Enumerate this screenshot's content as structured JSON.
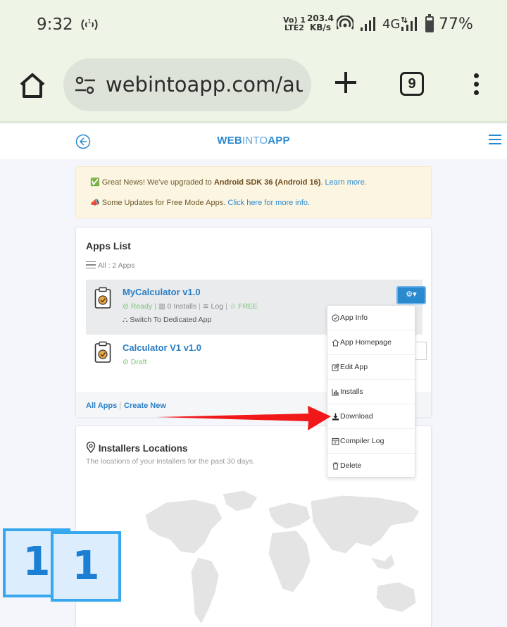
{
  "status_bar": {
    "time": "9:32",
    "volte_line1": "Vo) 1",
    "volte_line2": "LTE2",
    "speed_value": "203.4",
    "speed_unit": "KB/s",
    "network": "4G",
    "battery_percent_text": "77%",
    "battery_level": 0.77
  },
  "browser": {
    "url": "webintoapp.com/aut",
    "tab_count": "9",
    "icons": [
      "home-icon",
      "tune-icon",
      "plus-icon",
      "tabs-icon",
      "more-vert-icon"
    ]
  },
  "site_header": {
    "logo_part1": "WEB",
    "logo_part2": "INTO",
    "logo_part3": "APP"
  },
  "alerts": {
    "line1_emoji": "✅",
    "line1_text": "Great News! We've upgraded to ",
    "line1_bold": "Android SDK 36 (Android 16)",
    "line1_after": ". ",
    "line1_link": "Learn more.",
    "line2_emoji": "📣",
    "line2_text": "Some Updates for Free Mode Apps. ",
    "line2_link": "Click here for more info."
  },
  "apps_card": {
    "title": "Apps List",
    "count_label": "All : 2 Apps",
    "apps": [
      {
        "name": "MyCalculator v1.0",
        "status": "Ready",
        "installs": "0 Installs",
        "log": "Log",
        "plan": "FREE",
        "switch_label": "Switch To Dedicated App"
      },
      {
        "name": "Calculator V1 v1.0",
        "status": "Draft"
      }
    ],
    "footer_all": "All Apps",
    "footer_sep": "|",
    "footer_create": "Create New"
  },
  "dropdown": {
    "items": [
      {
        "label": "App Info",
        "icon": "check-circle-icon"
      },
      {
        "label": "App Homepage",
        "icon": "home-icon"
      },
      {
        "label": "Edit App",
        "icon": "edit-icon"
      },
      {
        "label": "Installs",
        "icon": "bar-chart-icon"
      },
      {
        "label": "Download",
        "icon": "download-icon"
      },
      {
        "label": "Compiler Log",
        "icon": "calendar-icon"
      },
      {
        "label": "Delete",
        "icon": "trash-icon"
      }
    ]
  },
  "locations_card": {
    "title": "Installers Locations",
    "subtitle": "The locations of your installers for the past 30 days."
  },
  "overlay": {
    "count_box_1": "1",
    "count_box_2": "1",
    "arrow_color": "#f01818"
  },
  "colors": {
    "brand_blue": "#2a8ad0",
    "ready_green": "#7cc576",
    "alert_bg": "#fcf5e2",
    "browser_chrome": "#eef5e6"
  }
}
